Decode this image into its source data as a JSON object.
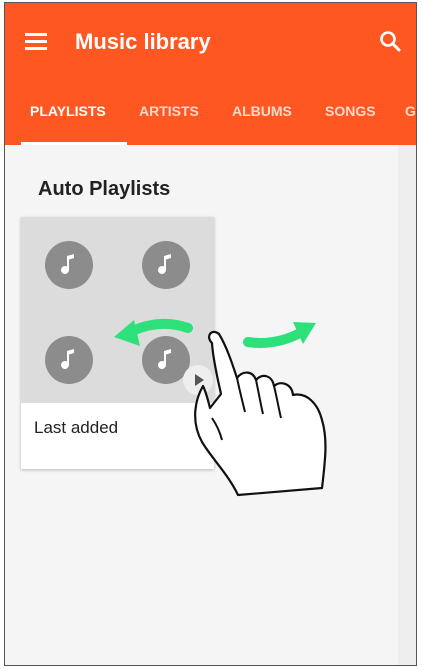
{
  "appbar": {
    "title": "Music library",
    "menu_icon": "hamburger-menu-icon",
    "search_icon": "search-icon",
    "color": "#ff5722"
  },
  "tabs": [
    {
      "label": "PLAYLISTS",
      "active": true
    },
    {
      "label": "ARTISTS",
      "active": false
    },
    {
      "label": "ALBUMS",
      "active": false
    },
    {
      "label": "SONGS",
      "active": false
    },
    {
      "label": "GE",
      "active": false
    }
  ],
  "section": {
    "title": "Auto Playlists"
  },
  "playlist_card": {
    "label": "Last added",
    "art_icons": [
      "music-note-icon",
      "music-note-icon",
      "music-note-icon",
      "music-note-icon"
    ],
    "play_icon": "play-icon",
    "more_icon": "more-vert-icon"
  },
  "gesture": {
    "hand_icon": "swipe-hand-icon",
    "arrow_left_icon": "arrow-left-icon",
    "arrow_right_icon": "arrow-right-icon",
    "arrow_color": "#2ee07a"
  }
}
